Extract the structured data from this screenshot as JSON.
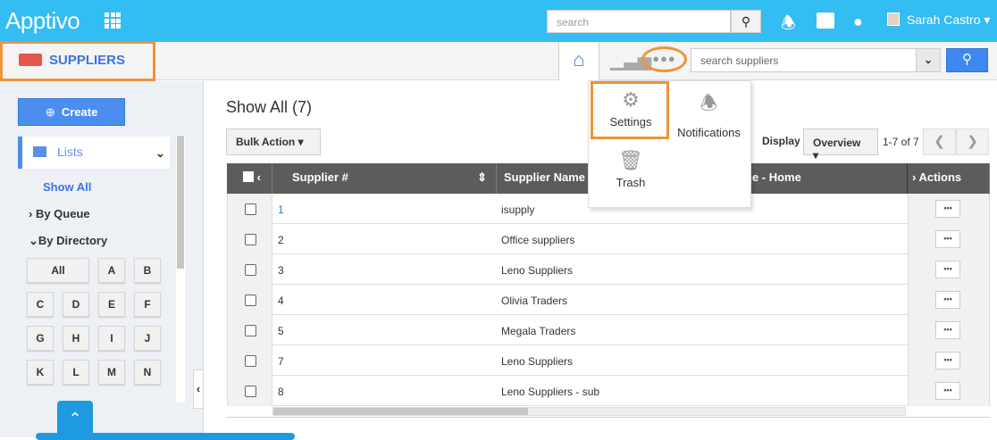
{
  "topbar": {
    "logo": "Apptivo",
    "search_placeholder": "search",
    "user_name": "Sarah Castro"
  },
  "app": {
    "name": "SUPPLIERS",
    "search_placeholder": "search suppliers"
  },
  "more_menu": {
    "items": [
      {
        "label": "Settings",
        "icon": "gear-icon"
      },
      {
        "label": "Notifications",
        "icon": "bell-icon"
      },
      {
        "label": "Trash",
        "icon": "trash-icon"
      }
    ]
  },
  "sidebar": {
    "create_label": "Create",
    "lists_label": "Lists",
    "show_all": "Show All",
    "by_queue": "By Queue",
    "by_directory": "By Directory",
    "letters": [
      "All",
      "A",
      "B",
      "C",
      "D",
      "E",
      "F",
      "G",
      "H",
      "I",
      "J",
      "K",
      "L",
      "M",
      "N"
    ]
  },
  "main": {
    "title": "Show All (7)",
    "bulk_action": "Bulk Action",
    "display_label": "Display",
    "display_value": "Overview",
    "page_info": "1-7 of 7",
    "columns": [
      "Supplier #",
      "Supplier Name",
      "ne - Home",
      "Actions"
    ],
    "rows": [
      {
        "num": "1",
        "name": "isupply"
      },
      {
        "num": "2",
        "name": "Office suppliers"
      },
      {
        "num": "3",
        "name": "Leno Suppliers"
      },
      {
        "num": "4",
        "name": "Olivia Traders"
      },
      {
        "num": "5",
        "name": "Megala Traders"
      },
      {
        "num": "7",
        "name": "Leno Suppliers"
      },
      {
        "num": "8",
        "name": "Leno Suppliers - sub"
      }
    ]
  },
  "colors": {
    "topbar": "#33bdf2",
    "accent": "#3b73e0",
    "highlight": "#ec943a"
  }
}
